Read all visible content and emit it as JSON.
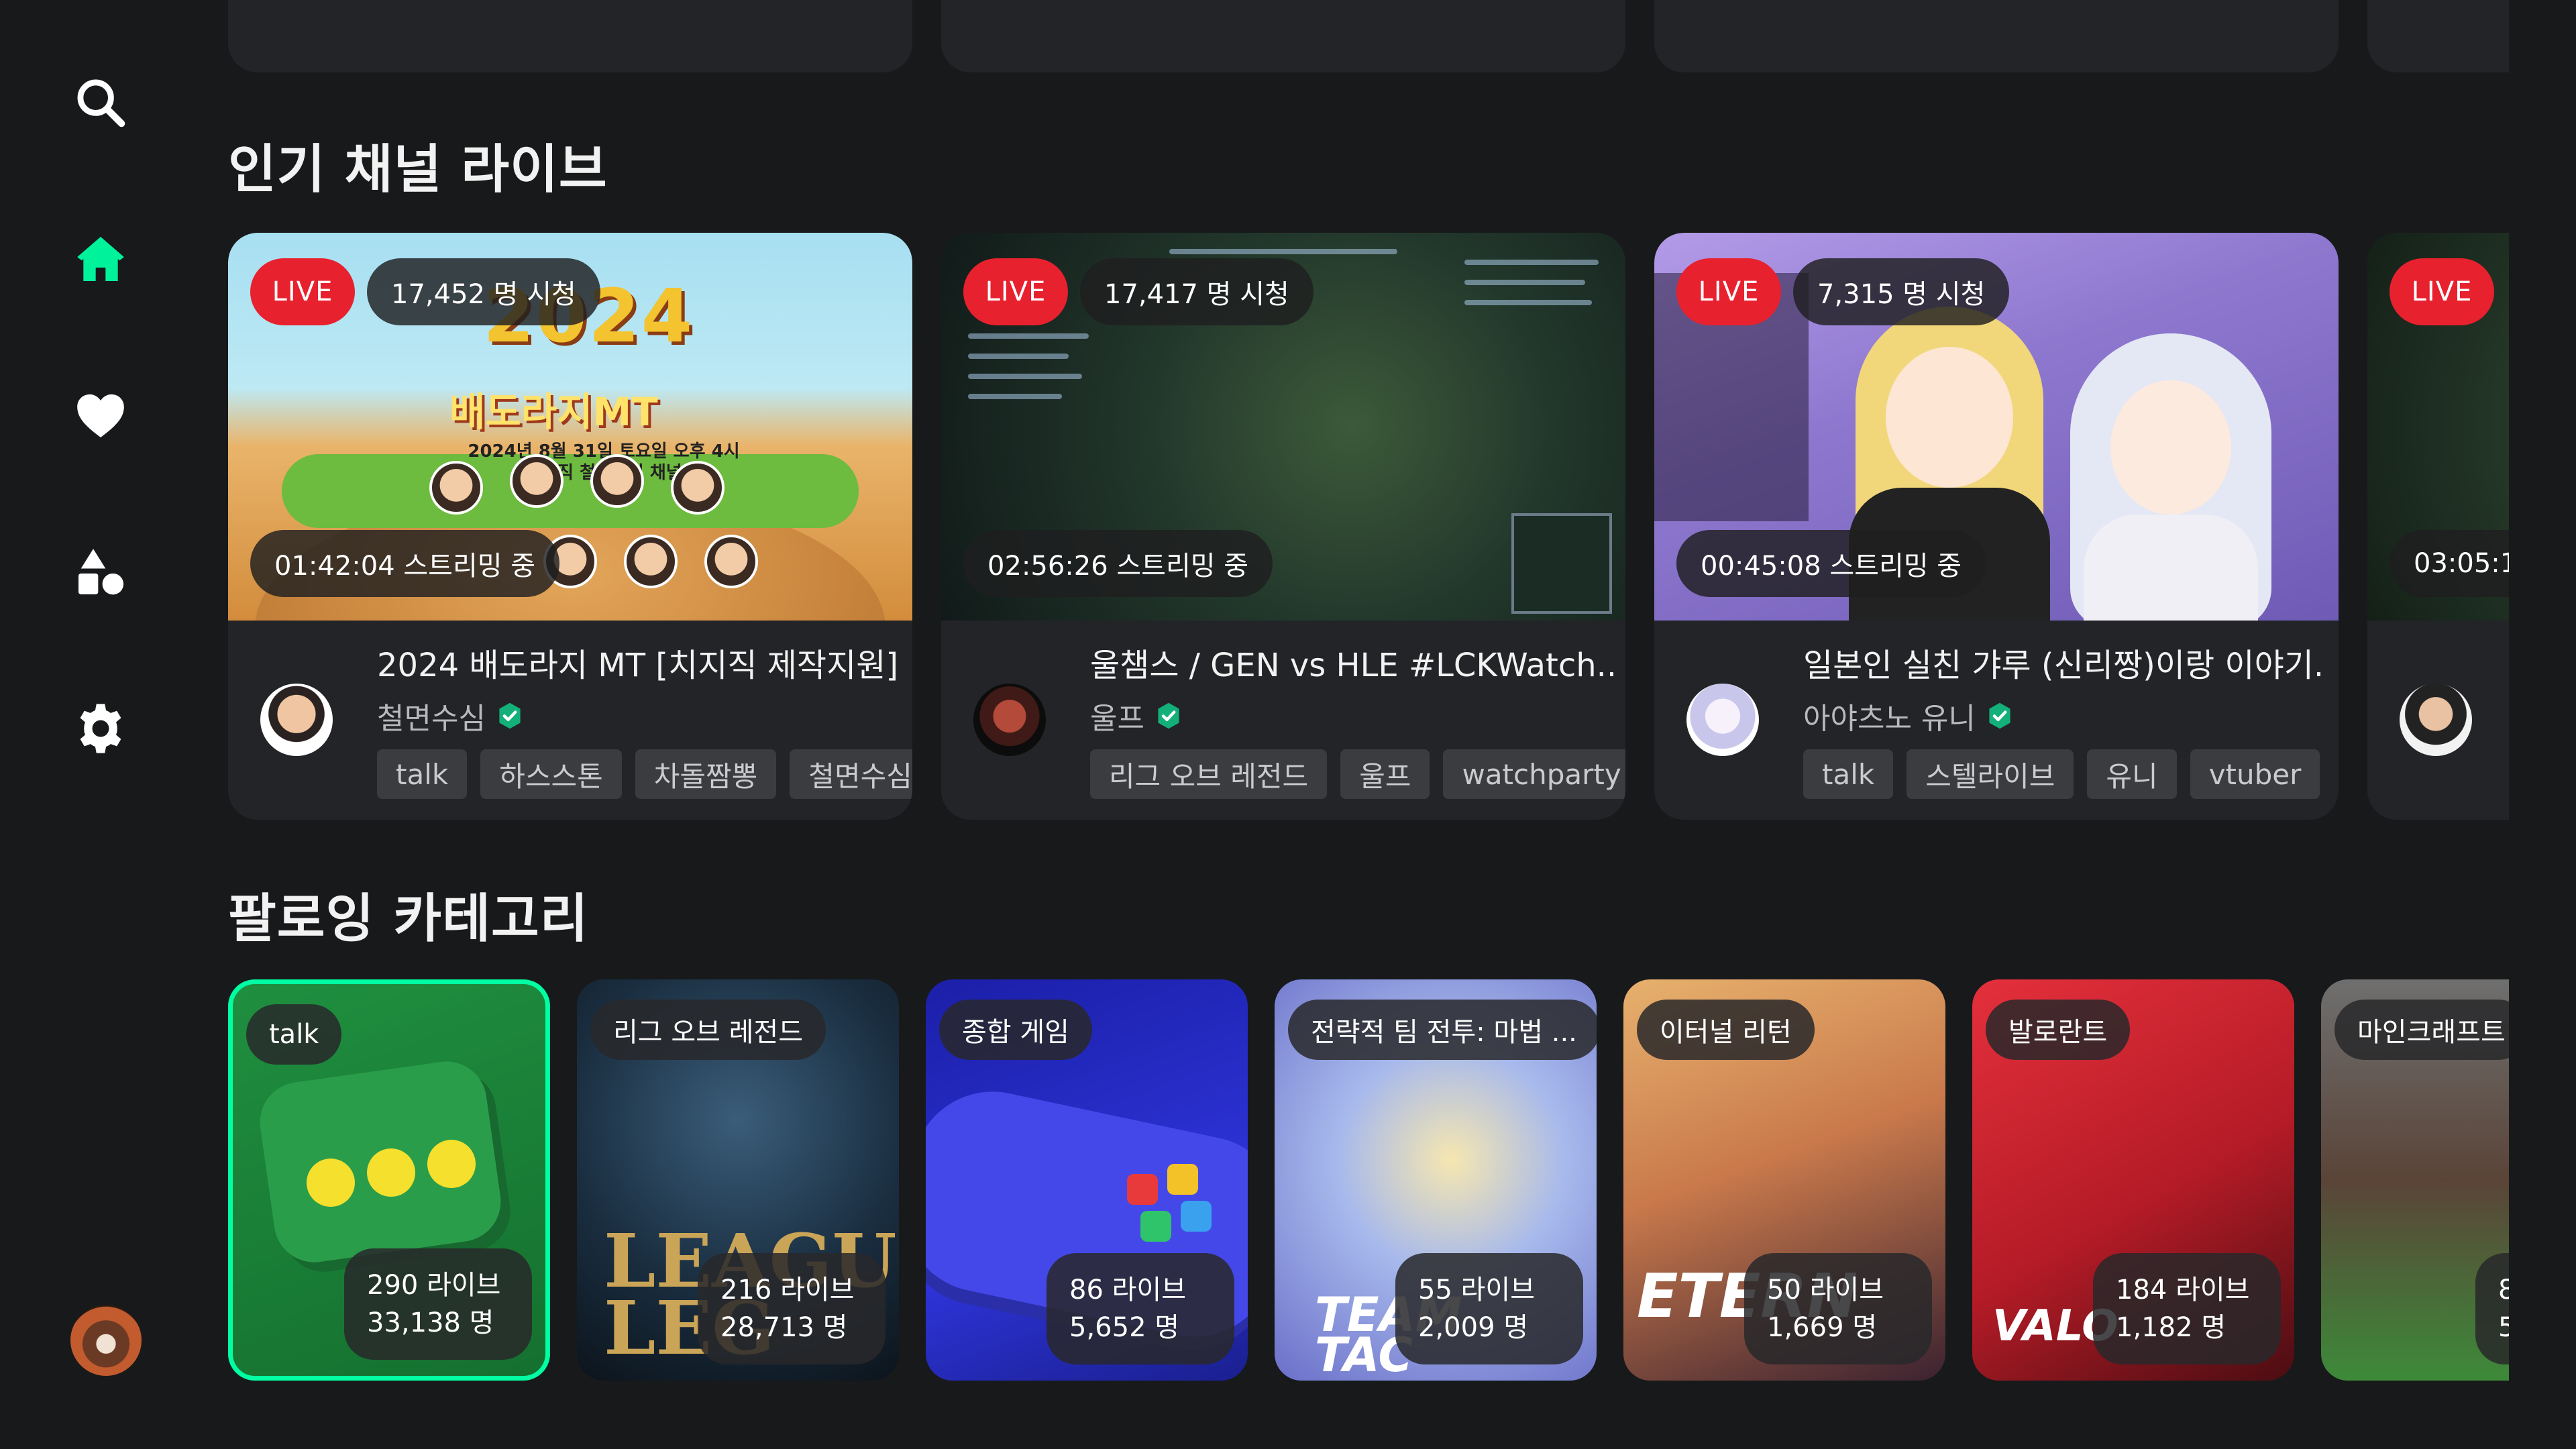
{
  "sidebar": {
    "items": [
      {
        "name": "search",
        "icon": "search-icon"
      },
      {
        "name": "home",
        "icon": "home-icon",
        "active": true
      },
      {
        "name": "following",
        "icon": "heart-icon"
      },
      {
        "name": "categories",
        "icon": "shapes-icon"
      },
      {
        "name": "settings",
        "icon": "gear-icon"
      }
    ],
    "profile_icon": "red-panda-avatar"
  },
  "popular_live": {
    "title": "인기 채널 라이브",
    "cards": [
      {
        "live_label": "LIVE",
        "viewers": "17,452 명 시청",
        "uptime": "01:42:04 스트리밍 중",
        "title": "2024 배도라지 MT [치지직 제작지원]",
        "channel": "철면수심",
        "verified": true,
        "tags": [
          "talk",
          "하스스톤",
          "차돌짬뽕",
          "철면수심"
        ],
        "poster": {
          "year": "2024",
          "headline": "배도라지MT",
          "date_line": "2024년 8월 31일 토요일 오후 4시",
          "channel_line": "치지직 철면수심 채널"
        }
      },
      {
        "live_label": "LIVE",
        "viewers": "17,417 명 시청",
        "uptime": "02:56:26 스트리밍 중",
        "title": "울챔스 / GEN vs HLE #LCKWatch...",
        "channel": "울프",
        "verified": true,
        "tags": [
          "리그 오브 레전드",
          "울프",
          "watchparty"
        ]
      },
      {
        "live_label": "LIVE",
        "viewers": "7,315 명 시청",
        "uptime": "00:45:08 스트리밍 중",
        "title": "일본인 실친 갸루 (신리짱)이랑 이야기...",
        "channel": "아야츠노 유니",
        "verified": true,
        "tags": [
          "talk",
          "스텔라이브",
          "유니",
          "vtuber"
        ]
      },
      {
        "live_label": "LIVE",
        "uptime": "03:05:1"
      }
    ]
  },
  "following_categories": {
    "title": "팔로잉 카테고리",
    "cards": [
      {
        "label": "talk",
        "lives": "290 라이브",
        "viewers": "33,138 명",
        "selected": true
      },
      {
        "label": "리그 오브 레전드",
        "lives": "216 라이브",
        "viewers": "28,713 명"
      },
      {
        "label": "종합 게임",
        "lives": "86 라이브",
        "viewers": "5,652 명"
      },
      {
        "label": "전략적 팀 전투: 마법 ...",
        "lives": "55 라이브",
        "viewers": "2,009 명"
      },
      {
        "label": "이터널 리턴",
        "lives": "50 라이브",
        "viewers": "1,669 명"
      },
      {
        "label": "발로란트",
        "lives": "184 라이브",
        "viewers": "1,182 명"
      },
      {
        "label": "마인크래프트",
        "lives": "8",
        "viewers": "5"
      }
    ]
  },
  "colors": {
    "background": "#18191b",
    "card": "#232427",
    "accent": "#00ffa3",
    "live_red": "#e8212e",
    "tag_bg": "#3a3c40"
  }
}
